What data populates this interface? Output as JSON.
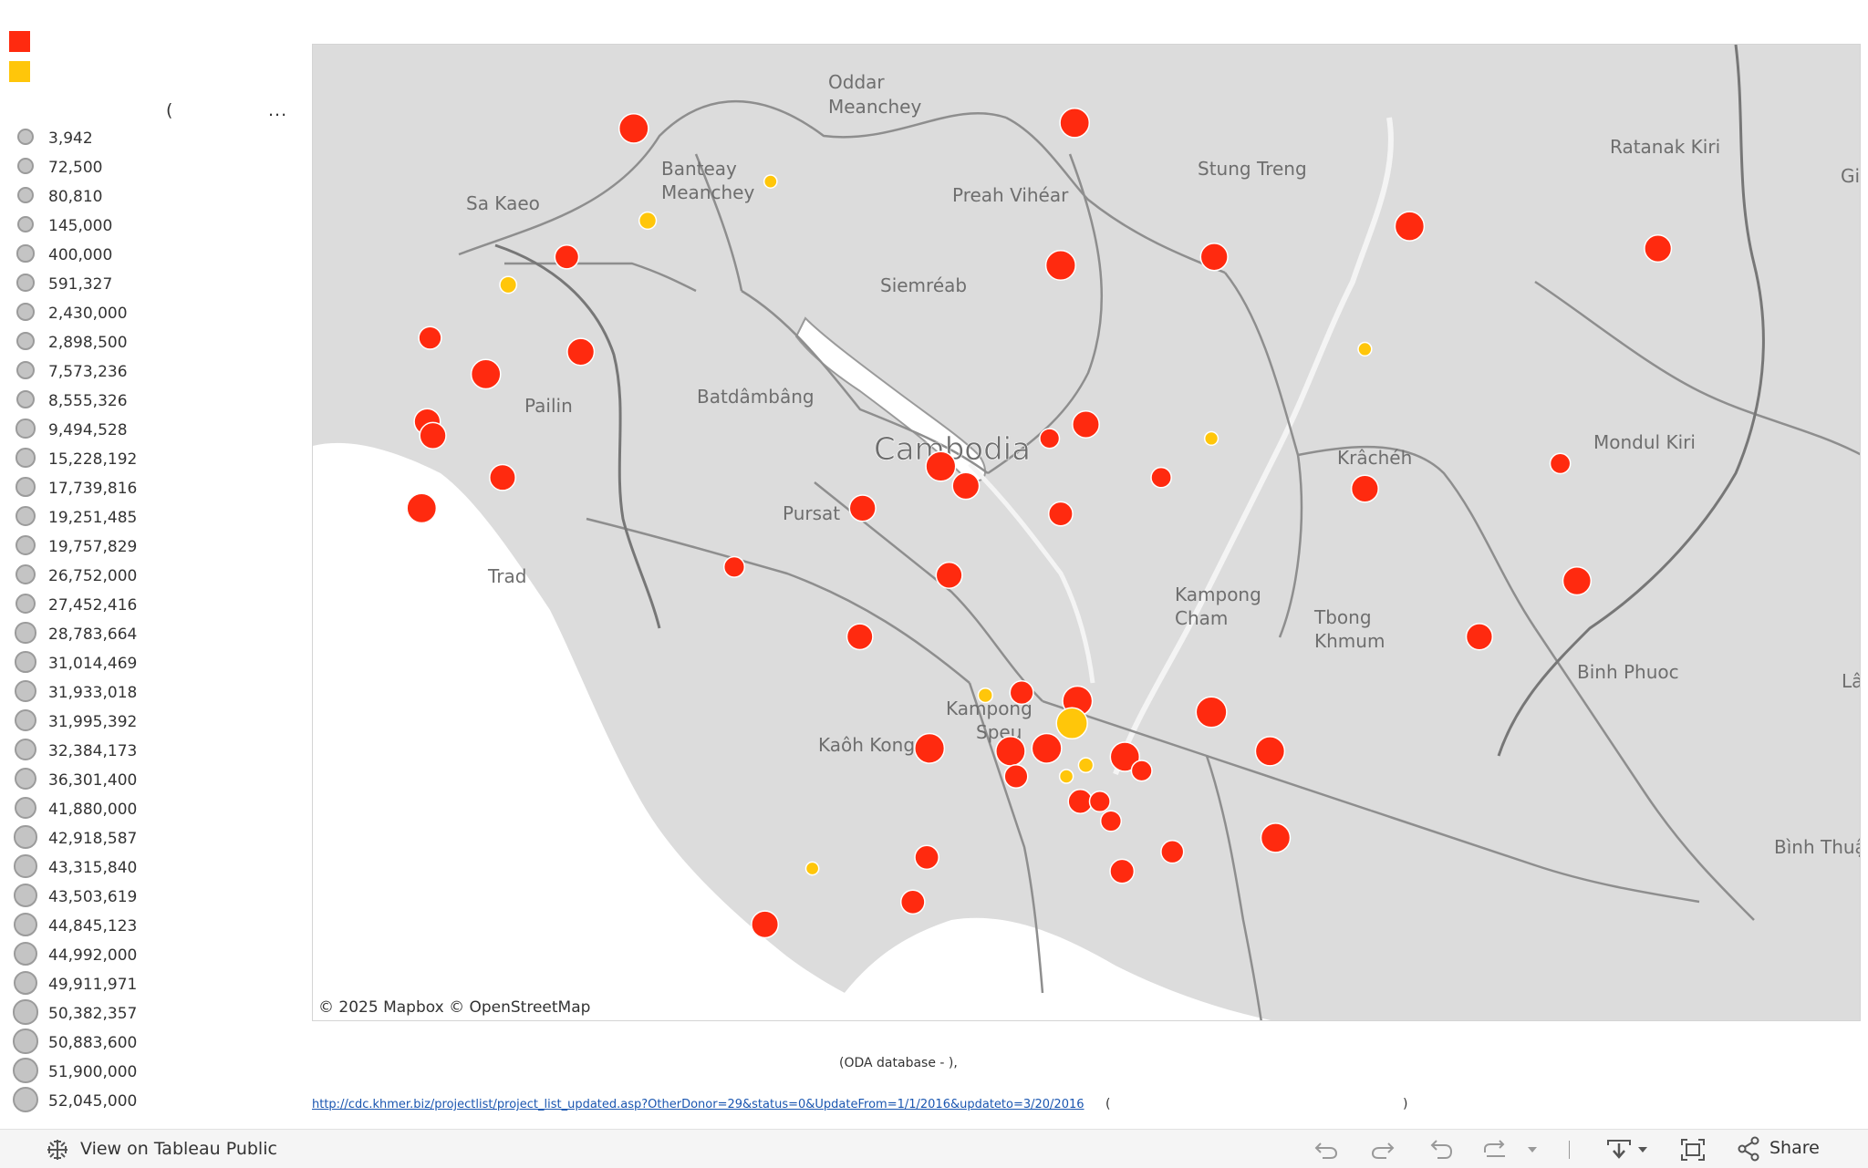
{
  "legend": {
    "colors": [
      {
        "color": "#ff2a0f"
      },
      {
        "color": "#ffc60a"
      }
    ],
    "size_header_paren": "(",
    "size_header_more": "...",
    "size_items": [
      "3,942",
      "72,500",
      "80,810",
      "145,000",
      "400,000",
      "591,327",
      "2,430,000",
      "2,898,500",
      "7,573,236",
      "8,555,326",
      "9,494,528",
      "15,228,192",
      "17,739,816",
      "19,251,485",
      "19,757,829",
      "26,752,000",
      "27,452,416",
      "28,783,664",
      "31,014,469",
      "31,933,018",
      "31,995,392",
      "32,384,173",
      "36,301,400",
      "41,880,000",
      "42,918,587",
      "43,315,840",
      "43,503,619",
      "44,845,123",
      "44,992,000",
      "49,911,971",
      "50,382,357",
      "50,883,600",
      "51,900,000",
      "52,045,000"
    ]
  },
  "map": {
    "attribution": "© 2025 Mapbox  © OpenStreetMap",
    "labels": [
      {
        "text": "Oddar",
        "size": 20
      },
      {
        "text": "Meanchey",
        "size": 20
      },
      {
        "text": "Banteay",
        "size": 20
      },
      {
        "text": "Meanchey",
        "size": 20
      },
      {
        "text": "Sa Kaeo",
        "size": 20
      },
      {
        "text": "Preah Vihéar",
        "size": 20
      },
      {
        "text": "Stung Treng",
        "size": 20
      },
      {
        "text": "Ratanak Kiri",
        "size": 20
      },
      {
        "text": "Gi",
        "size": 20
      },
      {
        "text": "Siemréab",
        "size": 20
      },
      {
        "text": "Batdâmbâng",
        "size": 20
      },
      {
        "text": "Pailin",
        "size": 20
      },
      {
        "text": "Cambodia",
        "size": 34
      },
      {
        "text": "Krâchéh",
        "size": 20
      },
      {
        "text": "Mondul Kiri",
        "size": 20
      },
      {
        "text": "Pursat",
        "size": 20
      },
      {
        "text": "Trad",
        "size": 20
      },
      {
        "text": "Kampong",
        "size": 20
      },
      {
        "text": "Cham",
        "size": 20
      },
      {
        "text": "Tbong",
        "size": 20
      },
      {
        "text": "Khmum",
        "size": 20
      },
      {
        "text": "Binh Phuoc",
        "size": 20
      },
      {
        "text": "Lâm Đ",
        "size": 20
      },
      {
        "text": "Kampong",
        "size": 20
      },
      {
        "text": "Speu",
        "size": 20
      },
      {
        "text": "Kaôh Kong",
        "size": 20
      },
      {
        "text": "Bình Thuậ",
        "size": 20
      }
    ],
    "marks": [
      {
        "cat": 0,
        "lon": 103.35,
        "lat": 14.2,
        "v": 43315840
      },
      {
        "cat": 0,
        "lon": 104.93,
        "lat": 14.22,
        "v": 43503619
      },
      {
        "cat": 0,
        "lon": 106.13,
        "lat": 13.85,
        "v": 41880000
      },
      {
        "cat": 0,
        "lon": 107.02,
        "lat": 13.77,
        "v": 31995392
      },
      {
        "cat": 1,
        "lon": 103.84,
        "lat": 14.01,
        "v": 3942
      },
      {
        "cat": 1,
        "lon": 103.4,
        "lat": 13.87,
        "v": 2898500
      },
      {
        "cat": 0,
        "lon": 103.11,
        "lat": 13.74,
        "v": 19251485
      },
      {
        "cat": 0,
        "lon": 104.88,
        "lat": 13.71,
        "v": 44845123
      },
      {
        "cat": 0,
        "lon": 105.43,
        "lat": 13.74,
        "v": 32384173
      },
      {
        "cat": 1,
        "lon": 102.9,
        "lat": 13.64,
        "v": 2430000
      },
      {
        "cat": 1,
        "lon": 105.97,
        "lat": 13.41,
        "v": 72500
      },
      {
        "cat": 0,
        "lon": 102.62,
        "lat": 13.45,
        "v": 15228192
      },
      {
        "cat": 0,
        "lon": 103.16,
        "lat": 13.4,
        "v": 31933018
      },
      {
        "cat": 0,
        "lon": 102.82,
        "lat": 13.32,
        "v": 42918587
      },
      {
        "cat": 0,
        "lon": 102.61,
        "lat": 13.15,
        "v": 27452416
      },
      {
        "cat": 0,
        "lon": 102.63,
        "lat": 13.1,
        "v": 28783664
      },
      {
        "cat": 0,
        "lon": 104.97,
        "lat": 13.14,
        "v": 31014469
      },
      {
        "cat": 0,
        "lon": 104.84,
        "lat": 13.09,
        "v": 7573236
      },
      {
        "cat": 1,
        "lon": 105.42,
        "lat": 13.09,
        "v": 80810
      },
      {
        "cat": 0,
        "lon": 104.45,
        "lat": 12.99,
        "v": 44992000
      },
      {
        "cat": 0,
        "lon": 106.67,
        "lat": 13.0,
        "v": 8555326
      },
      {
        "cat": 0,
        "lon": 102.88,
        "lat": 12.95,
        "v": 26752000
      },
      {
        "cat": 0,
        "lon": 105.24,
        "lat": 12.95,
        "v": 8555326
      },
      {
        "cat": 0,
        "lon": 104.54,
        "lat": 12.92,
        "v": 31014469
      },
      {
        "cat": 0,
        "lon": 105.97,
        "lat": 12.91,
        "v": 31933018
      },
      {
        "cat": 0,
        "lon": 102.59,
        "lat": 12.84,
        "v": 43503619
      },
      {
        "cat": 0,
        "lon": 104.17,
        "lat": 12.84,
        "v": 28783664
      },
      {
        "cat": 0,
        "lon": 104.88,
        "lat": 12.82,
        "v": 19757829
      },
      {
        "cat": 0,
        "lon": 103.71,
        "lat": 12.63,
        "v": 9494528
      },
      {
        "cat": 0,
        "lon": 104.48,
        "lat": 12.6,
        "v": 27452416
      },
      {
        "cat": 0,
        "lon": 106.73,
        "lat": 12.58,
        "v": 36301400
      },
      {
        "cat": 0,
        "lon": 104.16,
        "lat": 12.38,
        "v": 26752000
      },
      {
        "cat": 0,
        "lon": 106.38,
        "lat": 12.38,
        "v": 28783664
      },
      {
        "cat": 1,
        "lon": 104.61,
        "lat": 12.17,
        "v": 400000
      },
      {
        "cat": 0,
        "lon": 104.74,
        "lat": 12.18,
        "v": 17739816
      },
      {
        "cat": 0,
        "lon": 104.94,
        "lat": 12.15,
        "v": 44845123
      },
      {
        "cat": 0,
        "lon": 105.42,
        "lat": 12.11,
        "v": 49911971
      },
      {
        "cat": 1,
        "lon": 104.92,
        "lat": 12.07,
        "v": 52045000
      },
      {
        "cat": 0,
        "lon": 104.7,
        "lat": 11.97,
        "v": 42918587
      },
      {
        "cat": 0,
        "lon": 104.83,
        "lat": 11.98,
        "v": 44992000
      },
      {
        "cat": 0,
        "lon": 104.41,
        "lat": 11.98,
        "v": 44845123
      },
      {
        "cat": 0,
        "lon": 105.11,
        "lat": 11.95,
        "v": 41880000
      },
      {
        "cat": 0,
        "lon": 105.63,
        "lat": 11.97,
        "v": 41880000
      },
      {
        "cat": 1,
        "lon": 104.97,
        "lat": 11.92,
        "v": 591327
      },
      {
        "cat": 0,
        "lon": 105.17,
        "lat": 11.9,
        "v": 9494528
      },
      {
        "cat": 0,
        "lon": 104.72,
        "lat": 11.88,
        "v": 17739816
      },
      {
        "cat": 1,
        "lon": 104.9,
        "lat": 11.88,
        "v": 145000
      },
      {
        "cat": 0,
        "lon": 104.95,
        "lat": 11.79,
        "v": 19757829
      },
      {
        "cat": 0,
        "lon": 105.02,
        "lat": 11.79,
        "v": 9494528
      },
      {
        "cat": 0,
        "lon": 105.06,
        "lat": 11.72,
        "v": 9494528
      },
      {
        "cat": 0,
        "lon": 105.65,
        "lat": 11.66,
        "v": 41880000
      },
      {
        "cat": 0,
        "lon": 105.28,
        "lat": 11.61,
        "v": 15228192
      },
      {
        "cat": 0,
        "lon": 104.4,
        "lat": 11.59,
        "v": 19251485
      },
      {
        "cat": 1,
        "lon": 103.99,
        "lat": 11.55,
        "v": 3942
      },
      {
        "cat": 0,
        "lon": 105.1,
        "lat": 11.54,
        "v": 19757829
      },
      {
        "cat": 0,
        "lon": 104.35,
        "lat": 11.43,
        "v": 19251485
      },
      {
        "cat": 0,
        "lon": 103.82,
        "lat": 11.35,
        "v": 31014469
      }
    ]
  },
  "footer": {
    "caption": "(ODA database                              -        ),",
    "link": "http://cdc.khmer.biz/projectlist/project_list_updated.asp?OtherDonor=29&status=0&UpdateFrom=1/1/2016&updateto=3/20/2016",
    "link_paren_open": "(",
    "link_paren_close": ")"
  },
  "toolbar": {
    "view_label": "View on Tableau Public",
    "share_label": "Share",
    "icons": [
      "undo-icon",
      "redo-icon",
      "revert-icon",
      "refresh-icon",
      "pause-dropdown-icon",
      "download-icon",
      "fullscreen-icon",
      "share-icon"
    ]
  }
}
